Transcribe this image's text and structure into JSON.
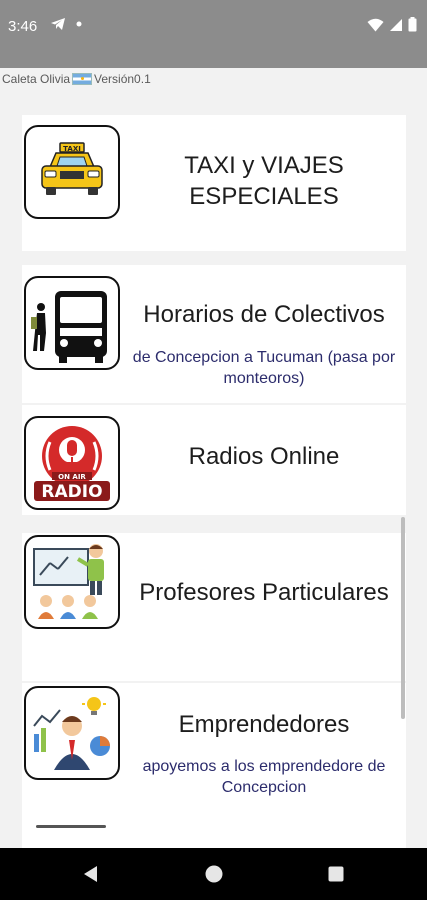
{
  "status_bar": {
    "time": "3:46",
    "left_icons": [
      "telegram-icon",
      "dot-icon"
    ],
    "right_icons": [
      "wifi-icon",
      "signal-icon",
      "battery-icon"
    ]
  },
  "header": {
    "title_prefix": "Caleta Olivia",
    "title_suffix": "Versión0.1",
    "flag_icon": "argentina-flag-icon"
  },
  "items": [
    {
      "title": "TAXI y VIAJES ESPECIALES",
      "subtitle": "",
      "icon": "taxi-icon"
    },
    {
      "title": "Horarios de Colectivos",
      "subtitle": "de Concepcion a Tucuman (pasa por monteoros)",
      "icon": "bus-icon"
    },
    {
      "title": "Radios Online",
      "subtitle": "",
      "icon": "radio-on-air-icon",
      "icon_text": "ON AIR RADIO"
    },
    {
      "title": "Profesores Particulares",
      "subtitle": "",
      "icon": "teacher-icon"
    },
    {
      "title": "Emprendedores",
      "subtitle": "apoyemos a los emprendedore de Concepcion",
      "icon": "entrepreneur-icon"
    }
  ],
  "nav_bar": {
    "buttons": [
      "back-icon",
      "home-icon",
      "recents-icon"
    ]
  },
  "colors": {
    "status_bar": "#8c8c8c",
    "card": "#ffffff",
    "background": "#f2f2f2",
    "subtitle_text": "#2c2c6c"
  }
}
